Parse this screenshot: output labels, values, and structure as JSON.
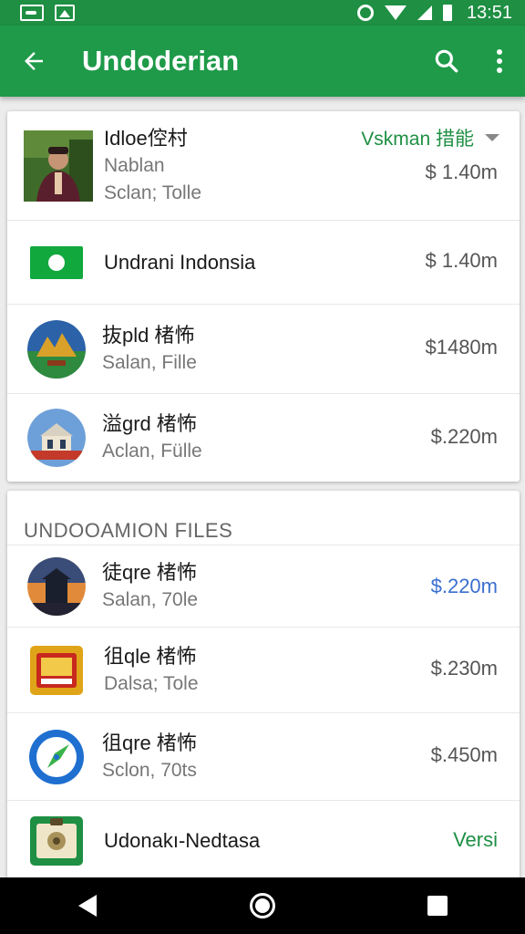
{
  "status_bar": {
    "time": "13:51"
  },
  "app_bar": {
    "title": "Undoderian"
  },
  "card1": {
    "dropdown_label": "Vskman 措能",
    "rows": [
      {
        "title": "Idloe倥村",
        "subtitle": "Nablan",
        "subtitle2": "Sclan; Tolle",
        "price": "$ 1.40m"
      },
      {
        "title": "Undrani Indonsia",
        "price": "$ 1.40m"
      },
      {
        "title": "抜pld 楮怖",
        "subtitle": "Salan, Fille",
        "price": "$1480m"
      },
      {
        "title": "溢grd 楮怖",
        "subtitle": "Aclan, Fülle",
        "price": "$.220m"
      }
    ]
  },
  "card2": {
    "section_title": "UNDOOAMION FILES",
    "rows": [
      {
        "title": "徒qre 楮怖",
        "subtitle": "Salan, 70le",
        "price": "$.220m",
        "price_color": "#3a6fcf"
      },
      {
        "title": "徂qle 楮怖",
        "subtitle": "Dalsa; Tole",
        "price": "$.230m"
      },
      {
        "title": "徂qre 楮怖",
        "subtitle": "Sclon, 70ts",
        "price": "$.450m"
      },
      {
        "title": "Udonakı-Nedtasa",
        "price": "Versi",
        "price_color": "#1e8f43"
      }
    ]
  },
  "colors": {
    "primary": "#1e9a49",
    "status": "#1e8f43",
    "accent_blue": "#3a6fcf"
  }
}
